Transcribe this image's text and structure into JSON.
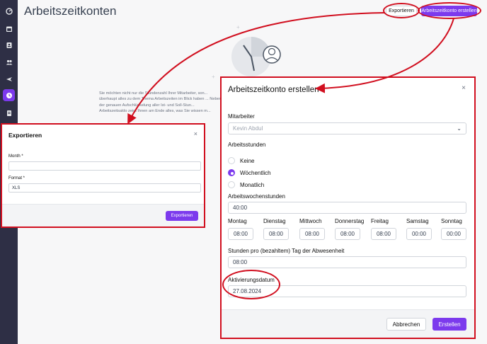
{
  "page": {
    "title": "Arbeitszeitkonten"
  },
  "header": {
    "export_label": "Exportieren",
    "create_label": "Arbeitszeitkonto erstellen"
  },
  "sidebar": {
    "items": [
      {
        "icon": "dashboard-icon"
      },
      {
        "icon": "calendar-icon"
      },
      {
        "icon": "contact-card-icon"
      },
      {
        "icon": "users-icon"
      },
      {
        "icon": "airplane-icon"
      },
      {
        "icon": "clock-icon",
        "active": true
      },
      {
        "icon": "document-icon"
      }
    ]
  },
  "background": {
    "text": "Sie möchten nicht nur die Stundenzahl Ihrer Mitarbeiter, son... überhaupt alles zu dem Thema Arbeitszeiten im Blick haben ... Neben der genauen Aufschlüsselung aller Ist- und Soll-Stun... Arbeitszeitsaldo zeigt Ihnen am Ende alles, was Sie wissen m..."
  },
  "export_modal": {
    "title": "Exportieren",
    "close": "×",
    "month_label": "Month *",
    "month_value": "",
    "format_label": "Format *",
    "format_value": "XLS",
    "submit_label": "Exportieren"
  },
  "create_modal": {
    "title": "Arbeitszeitkonto erstellen",
    "close": "×",
    "employee_label": "Mitarbeiter",
    "employee_value": "Kevin Abdul",
    "hours_label": "Arbeitsstunden",
    "radio_options": [
      "Keine",
      "Wöchentlich",
      "Monatlich"
    ],
    "radio_selected": "Wöchentlich",
    "week_hours_label": "Arbeitswochenstunden",
    "week_hours_value": "40:00",
    "days": [
      {
        "label": "Montag",
        "value": "08:00"
      },
      {
        "label": "Dienstag",
        "value": "08:00"
      },
      {
        "label": "Mittwoch",
        "value": "08:00"
      },
      {
        "label": "Donnerstag",
        "value": "08:00"
      },
      {
        "label": "Freitag",
        "value": "08:00"
      },
      {
        "label": "Samstag",
        "value": "00:00"
      },
      {
        "label": "Sonntag",
        "value": "00:00"
      }
    ],
    "absence_label": "Stunden pro (bezahltem) Tag der Abwesenheit",
    "absence_value": "08:00",
    "activation_label": "Aktivierungsdatum",
    "activation_value": "27.08.2024",
    "cancel_label": "Abbrechen",
    "submit_label": "Erstellen"
  },
  "colors": {
    "accent": "#7c3aed",
    "annotation": "#d10f1f",
    "sidebar": "#2e2f45"
  }
}
